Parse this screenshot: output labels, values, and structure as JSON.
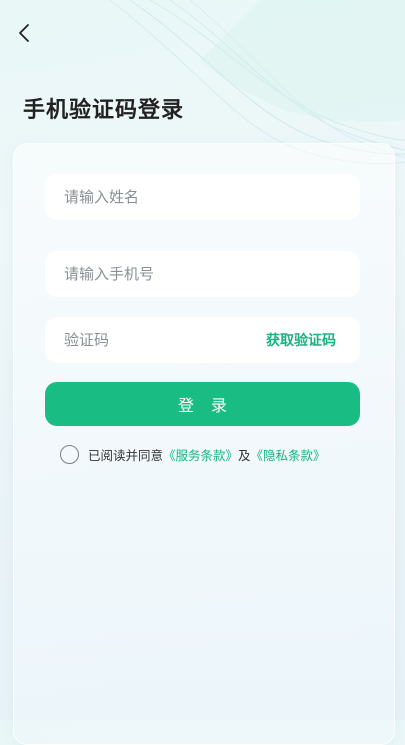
{
  "header": {
    "back_icon": "chevron-left-icon",
    "title": "手机验证码登录"
  },
  "form": {
    "name_placeholder": "请输入姓名",
    "phone_placeholder": "请输入手机号",
    "code_placeholder": "验证码",
    "get_code_label": "获取验证码",
    "login_label": "登 录"
  },
  "agreement": {
    "prefix": "已阅读并同意",
    "service_terms": "《服务条款》",
    "and": "及",
    "privacy_terms": "《隐私条款》",
    "checked": false
  },
  "colors": {
    "accent": "#19bd83",
    "link": "#19b37e",
    "title": "#222222",
    "placeholder": "#8a8f96"
  }
}
